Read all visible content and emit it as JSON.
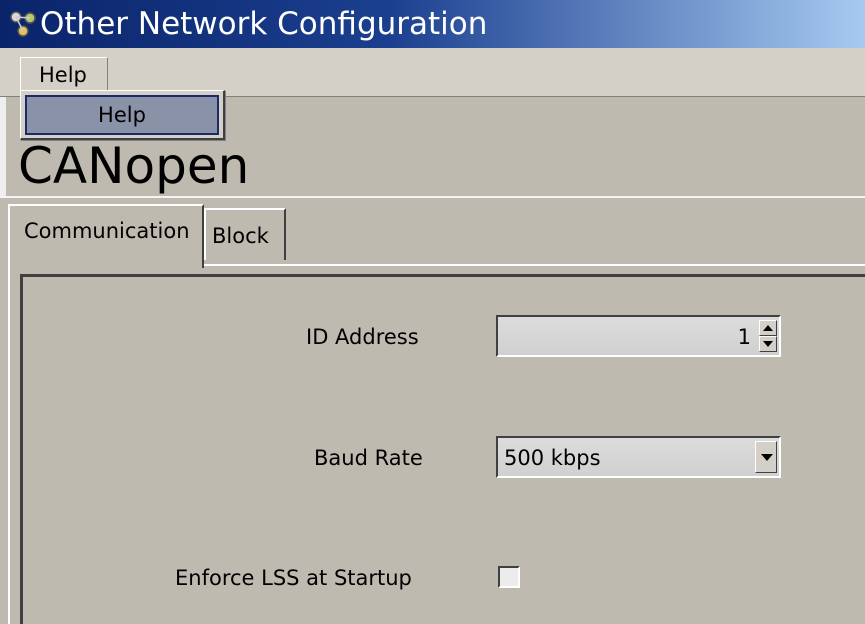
{
  "window": {
    "title": "Other Network Configuration",
    "icon": "network-icon"
  },
  "menubar": {
    "help_label": "Help"
  },
  "dropdown": {
    "items": [
      {
        "label": "Help"
      }
    ]
  },
  "page": {
    "title": "CANopen"
  },
  "tabs": [
    {
      "label": "Communication",
      "selected": true
    },
    {
      "label": "Block",
      "selected": false
    }
  ],
  "form": {
    "id_address": {
      "label": "ID Address",
      "value": "1"
    },
    "baud_rate": {
      "label": "Baud Rate",
      "value": "500 kbps"
    },
    "enforce_lss": {
      "label": "Enforce LSS at Startup",
      "checked": false
    }
  },
  "colors": {
    "titlebar_start": "#0a246a",
    "titlebar_end": "#a6caf0",
    "highlight": "#8a92a8"
  }
}
